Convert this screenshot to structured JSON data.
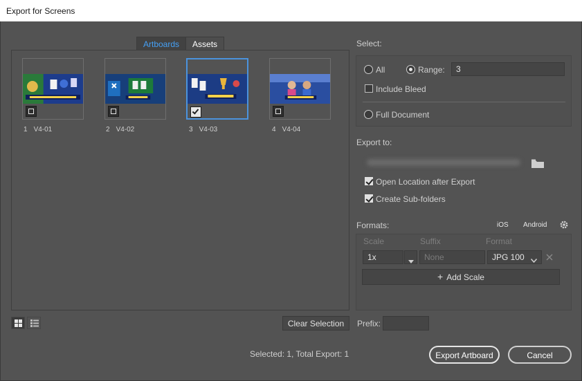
{
  "window": {
    "title": "Export for Screens"
  },
  "tabs": [
    {
      "label": "Artboards",
      "active": true
    },
    {
      "label": "Assets",
      "active": false
    }
  ],
  "artboards": [
    {
      "number": "1",
      "name": "V4-01",
      "checked": false,
      "banner": "ALL CLASSIC GAMES SOLITAIRE",
      "accent": "#1b3a8a"
    },
    {
      "number": "2",
      "name": "V4-02",
      "checked": false,
      "banner": "PLAY ONLINE",
      "accent": "#173f7a"
    },
    {
      "number": "3",
      "name": "V4-03",
      "checked": true,
      "banner": "REAL MONEY PRIZES",
      "accent": "#1c3c84"
    },
    {
      "number": "4",
      "name": "V4-04",
      "checked": false,
      "banner": "WIN CASH PLAYING",
      "accent": "#2a4ea0"
    }
  ],
  "view": {
    "grid_icon": "grid-view-icon",
    "list_icon": "list-view-icon"
  },
  "clear_selection": "Clear Selection",
  "status": "Selected: 1, Total Export: 1",
  "select": {
    "heading": "Select:",
    "all_label": "All",
    "range_label": "Range:",
    "range_value": "3",
    "include_bleed_label": "Include Bleed",
    "full_document_label": "Full Document",
    "selected_option": "range"
  },
  "export_to": {
    "heading": "Export to:",
    "folder_icon": "folder-icon",
    "open_location_label": "Open Location after Export",
    "open_location_checked": true,
    "subfolders_label": "Create Sub-folders",
    "subfolders_checked": true
  },
  "formats": {
    "heading": "Formats:",
    "ios_label": "iOS",
    "android_label": "Android",
    "gear_icon": "gear-icon",
    "columns": {
      "scale": "Scale",
      "suffix": "Suffix",
      "format": "Format"
    },
    "row": {
      "scale": "1x",
      "suffix_placeholder": "None",
      "format": "JPG 100"
    },
    "add_scale_label": "Add Scale"
  },
  "prefix": {
    "label": "Prefix:",
    "value": ""
  },
  "buttons": {
    "export": "Export Artboard",
    "cancel": "Cancel"
  },
  "colors": {
    "accent_blue": "#46a0f5",
    "selection_border": "#4b93de",
    "dialog_bg": "#535353"
  }
}
